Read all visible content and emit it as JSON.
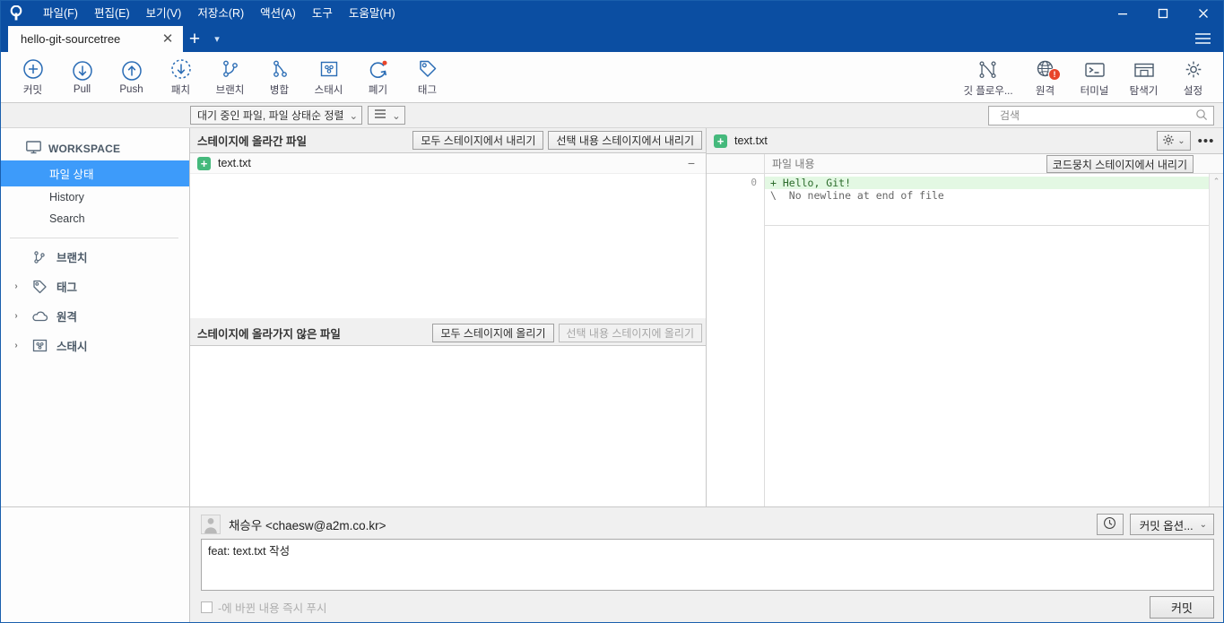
{
  "window": {
    "menus": [
      "파일(F)",
      "편집(E)",
      "보기(V)",
      "저장소(R)",
      "액션(A)",
      "도구",
      "도움말(H)"
    ],
    "controls": {
      "minimize": "minimize-icon",
      "maximize": "maximize-icon",
      "close": "close-icon",
      "menu": "hamburger-icon"
    }
  },
  "tabs": {
    "active": "hello-git-sourcetree",
    "close_label": "✕",
    "add_label": "+",
    "caret_label": "▾"
  },
  "toolbar": {
    "left": [
      {
        "label": "커밋",
        "icon": "plus-circle-icon"
      },
      {
        "label": "Pull",
        "icon": "arrow-down-circle-icon"
      },
      {
        "label": "Push",
        "icon": "arrow-up-circle-icon"
      },
      {
        "label": "패치",
        "icon": "arrow-down-dashed-circle-icon"
      },
      {
        "label": "브랜치",
        "icon": "branch-icon"
      },
      {
        "label": "병합",
        "icon": "merge-icon"
      },
      {
        "label": "스태시",
        "icon": "stash-icon"
      },
      {
        "label": "폐기",
        "icon": "discard-refresh-icon"
      },
      {
        "label": "태그",
        "icon": "tag-icon"
      }
    ],
    "right": [
      {
        "label": "깃 플로우...",
        "icon": "gitflow-icon",
        "badge": ""
      },
      {
        "label": "원격",
        "icon": "globe-icon",
        "badge": "!"
      },
      {
        "label": "터미널",
        "icon": "terminal-icon",
        "badge": ""
      },
      {
        "label": "탐색기",
        "icon": "folder-explorer-icon",
        "badge": ""
      },
      {
        "label": "설정",
        "icon": "gear-icon",
        "badge": ""
      }
    ]
  },
  "filterbar": {
    "sort_combo": "대기 중인 파일, 파일 상태순 정렬",
    "sort_caret": "⌄",
    "view_combo_icon": "list-view-icon",
    "view_caret": "⌄"
  },
  "search": {
    "placeholder": "검색",
    "value": "",
    "icon": "search-icon"
  },
  "sidebar": {
    "workspace": {
      "label": "WORKSPACE",
      "icon": "monitor-icon"
    },
    "workspace_items": [
      {
        "label": "파일 상태",
        "active": true
      },
      {
        "label": "History",
        "active": false
      },
      {
        "label": "Search",
        "active": false
      }
    ],
    "groups": [
      {
        "label": "브랜치",
        "icon": "branch-icon",
        "arrow": ""
      },
      {
        "label": "태그",
        "icon": "tag-icon",
        "arrow": "›"
      },
      {
        "label": "원격",
        "icon": "cloud-icon",
        "arrow": "›"
      },
      {
        "label": "스태시",
        "icon": "stash-icon",
        "arrow": "›"
      }
    ]
  },
  "staged": {
    "title": "스테이지에 올라간 파일",
    "unstage_all_label": "모두 스테이지에서 내리기",
    "unstage_selected_label": "선택 내용 스테이지에서 내리기",
    "files": [
      {
        "name": "text.txt",
        "status": "+",
        "status_color": "#45b97c",
        "collapse": "−"
      }
    ]
  },
  "unstaged": {
    "title": "스테이지에 올라가지 않은 파일",
    "stage_all_label": "모두 스테이지에 올리기",
    "stage_selected_label": "선택 내용 스테이지에 올리기",
    "files": []
  },
  "diff": {
    "file_name": "text.txt",
    "status": "+",
    "gear_caret": "⌄",
    "more_label": "•••",
    "content_label": "파일 내용",
    "unstage_hunk_label": "코드뭉치 스테이지에서 내리기",
    "scroll_up": "⌃",
    "lines": [
      {
        "num": "0",
        "text": "+ Hello, Git!",
        "type": "add"
      },
      {
        "num": "",
        "text": "\\  No newline at end of file",
        "type": "meta"
      }
    ]
  },
  "commit": {
    "author": "채승우 <chaesw@a2m.co.kr>",
    "avatar_icon": "user-avatar-icon",
    "history_icon": "clock-icon",
    "options_label": "커밋 옵션...",
    "options_caret": "⌄",
    "message": "feat: text.txt 작성",
    "message_placeholder": "",
    "push_checkbox_label": "-에 바뀐 내용 즉시 푸시",
    "push_checked": false,
    "commit_button_label": "커밋"
  },
  "colors": {
    "titlebar": "#0b4ea2",
    "selection": "#3d9bfa",
    "added": "#e3f8e3",
    "status_green": "#45b97c",
    "badge_red": "#e8442a",
    "icon_blue": "#2a6cb5"
  }
}
